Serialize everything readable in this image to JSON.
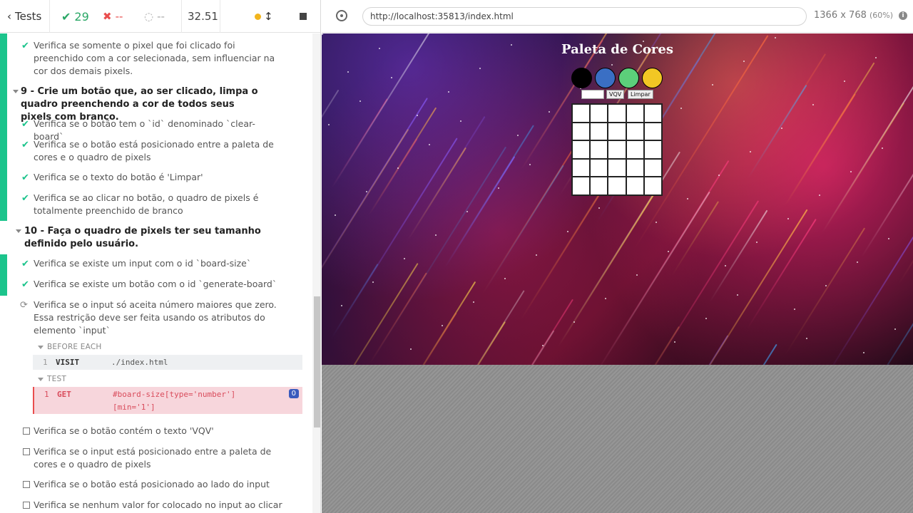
{
  "header": {
    "tests_label": "Tests",
    "passed": "29",
    "failed": "--",
    "pending": "--",
    "duration": "32.51"
  },
  "reporter": {
    "rows": [
      {
        "state": "passed",
        "text": "Verifica se somente o pixel que foi clicado foi preenchido com a cor selecionada, sem influenciar na cor dos demais pixels."
      },
      {
        "state": "suite",
        "text": "9 - Crie um botão que, ao ser clicado, limpa o quadro preenchendo a cor de todos seus pixels com branco."
      },
      {
        "state": "passed",
        "text": "Verifica se o botão tem o `id` denominado `clear-board`"
      },
      {
        "state": "passed",
        "text": "Verifica se o botão está posicionado entre a paleta de cores e o quadro de pixels"
      },
      {
        "state": "passed",
        "text": "Verifica se o texto do botão é 'Limpar'"
      },
      {
        "state": "passed",
        "text": "Verifica se ao clicar no botão, o quadro de pixels é totalmente preenchido de branco"
      },
      {
        "state": "suite",
        "text": "10 - Faça o quadro de pixels ter seu tamanho definido pelo usuário."
      },
      {
        "state": "passed",
        "text": "Verifica se existe um input com o id `board-size`"
      },
      {
        "state": "passed",
        "text": "Verifica se existe um botão com o id `generate-board`"
      },
      {
        "state": "running",
        "text": "Verifica se o input só aceita número maiores que zero. Essa restrição deve ser feita usando os atributos do elemento `input`"
      },
      {
        "state": "pending",
        "text": "Verifica se o botão contém o texto 'VQV'"
      },
      {
        "state": "pending",
        "text": "Verifica se o input está posicionado entre a paleta de cores e o quadro de pixels"
      },
      {
        "state": "pending",
        "text": "Verifica se o botão está posicionado ao lado do input"
      },
      {
        "state": "pending",
        "text": "Verifica se nenhum valor for colocado no input ao clicar no"
      }
    ],
    "before_each_label": "BEFORE EACH",
    "test_label": "TEST",
    "commands": {
      "visit": {
        "num": "1",
        "name": "VISIT",
        "message": "./index.html"
      },
      "get": {
        "num": "1",
        "name": "GET",
        "message": "#board-size[type='number'] [min='1']",
        "badge": "0"
      }
    }
  },
  "browser": {
    "url": "http://localhost:35813/index.html",
    "viewport": "1366 x 768",
    "scale": "(60%)"
  },
  "app": {
    "title": "Paleta de Cores",
    "palette_colors": [
      "#000000",
      "#3a6fc4",
      "#5ccf7a",
      "#f2c724"
    ],
    "vqv_label": "VQV",
    "clear_label": "Limpar",
    "board_size": 5
  }
}
